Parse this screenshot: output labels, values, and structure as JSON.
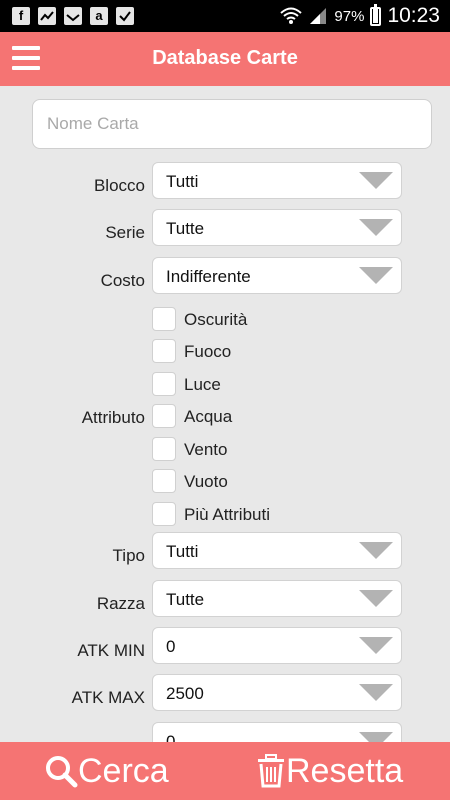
{
  "status_bar": {
    "notification_icons": [
      "facebook-icon",
      "gallery-icon",
      "inbox-icon",
      "amazon-icon",
      "task-icon"
    ],
    "battery_percent": "97%",
    "time": "10:23"
  },
  "app_bar": {
    "title": "Database Carte",
    "color": "#f57473"
  },
  "search": {
    "placeholder": "Nome Carta",
    "value": ""
  },
  "filters": {
    "blocco": {
      "label": "Blocco",
      "value": "Tutti"
    },
    "serie": {
      "label": "Serie",
      "value": "Tutte"
    },
    "costo": {
      "label": "Costo",
      "value": "Indifferente"
    },
    "attributo": {
      "label": "Attributo",
      "options": [
        "Oscurità",
        "Fuoco",
        "Luce",
        "Acqua",
        "Vento",
        "Vuoto",
        "Più Attributi"
      ]
    },
    "tipo": {
      "label": "Tipo",
      "value": "Tutti"
    },
    "razza": {
      "label": "Razza",
      "value": "Tutte"
    },
    "atk_min": {
      "label": "ATK MIN",
      "value": "0"
    },
    "atk_max": {
      "label": "ATK MAX",
      "value": "2500"
    },
    "next": {
      "label": "",
      "value": "0"
    }
  },
  "actions": {
    "search_label": "Cerca",
    "reset_label": "Resetta"
  }
}
